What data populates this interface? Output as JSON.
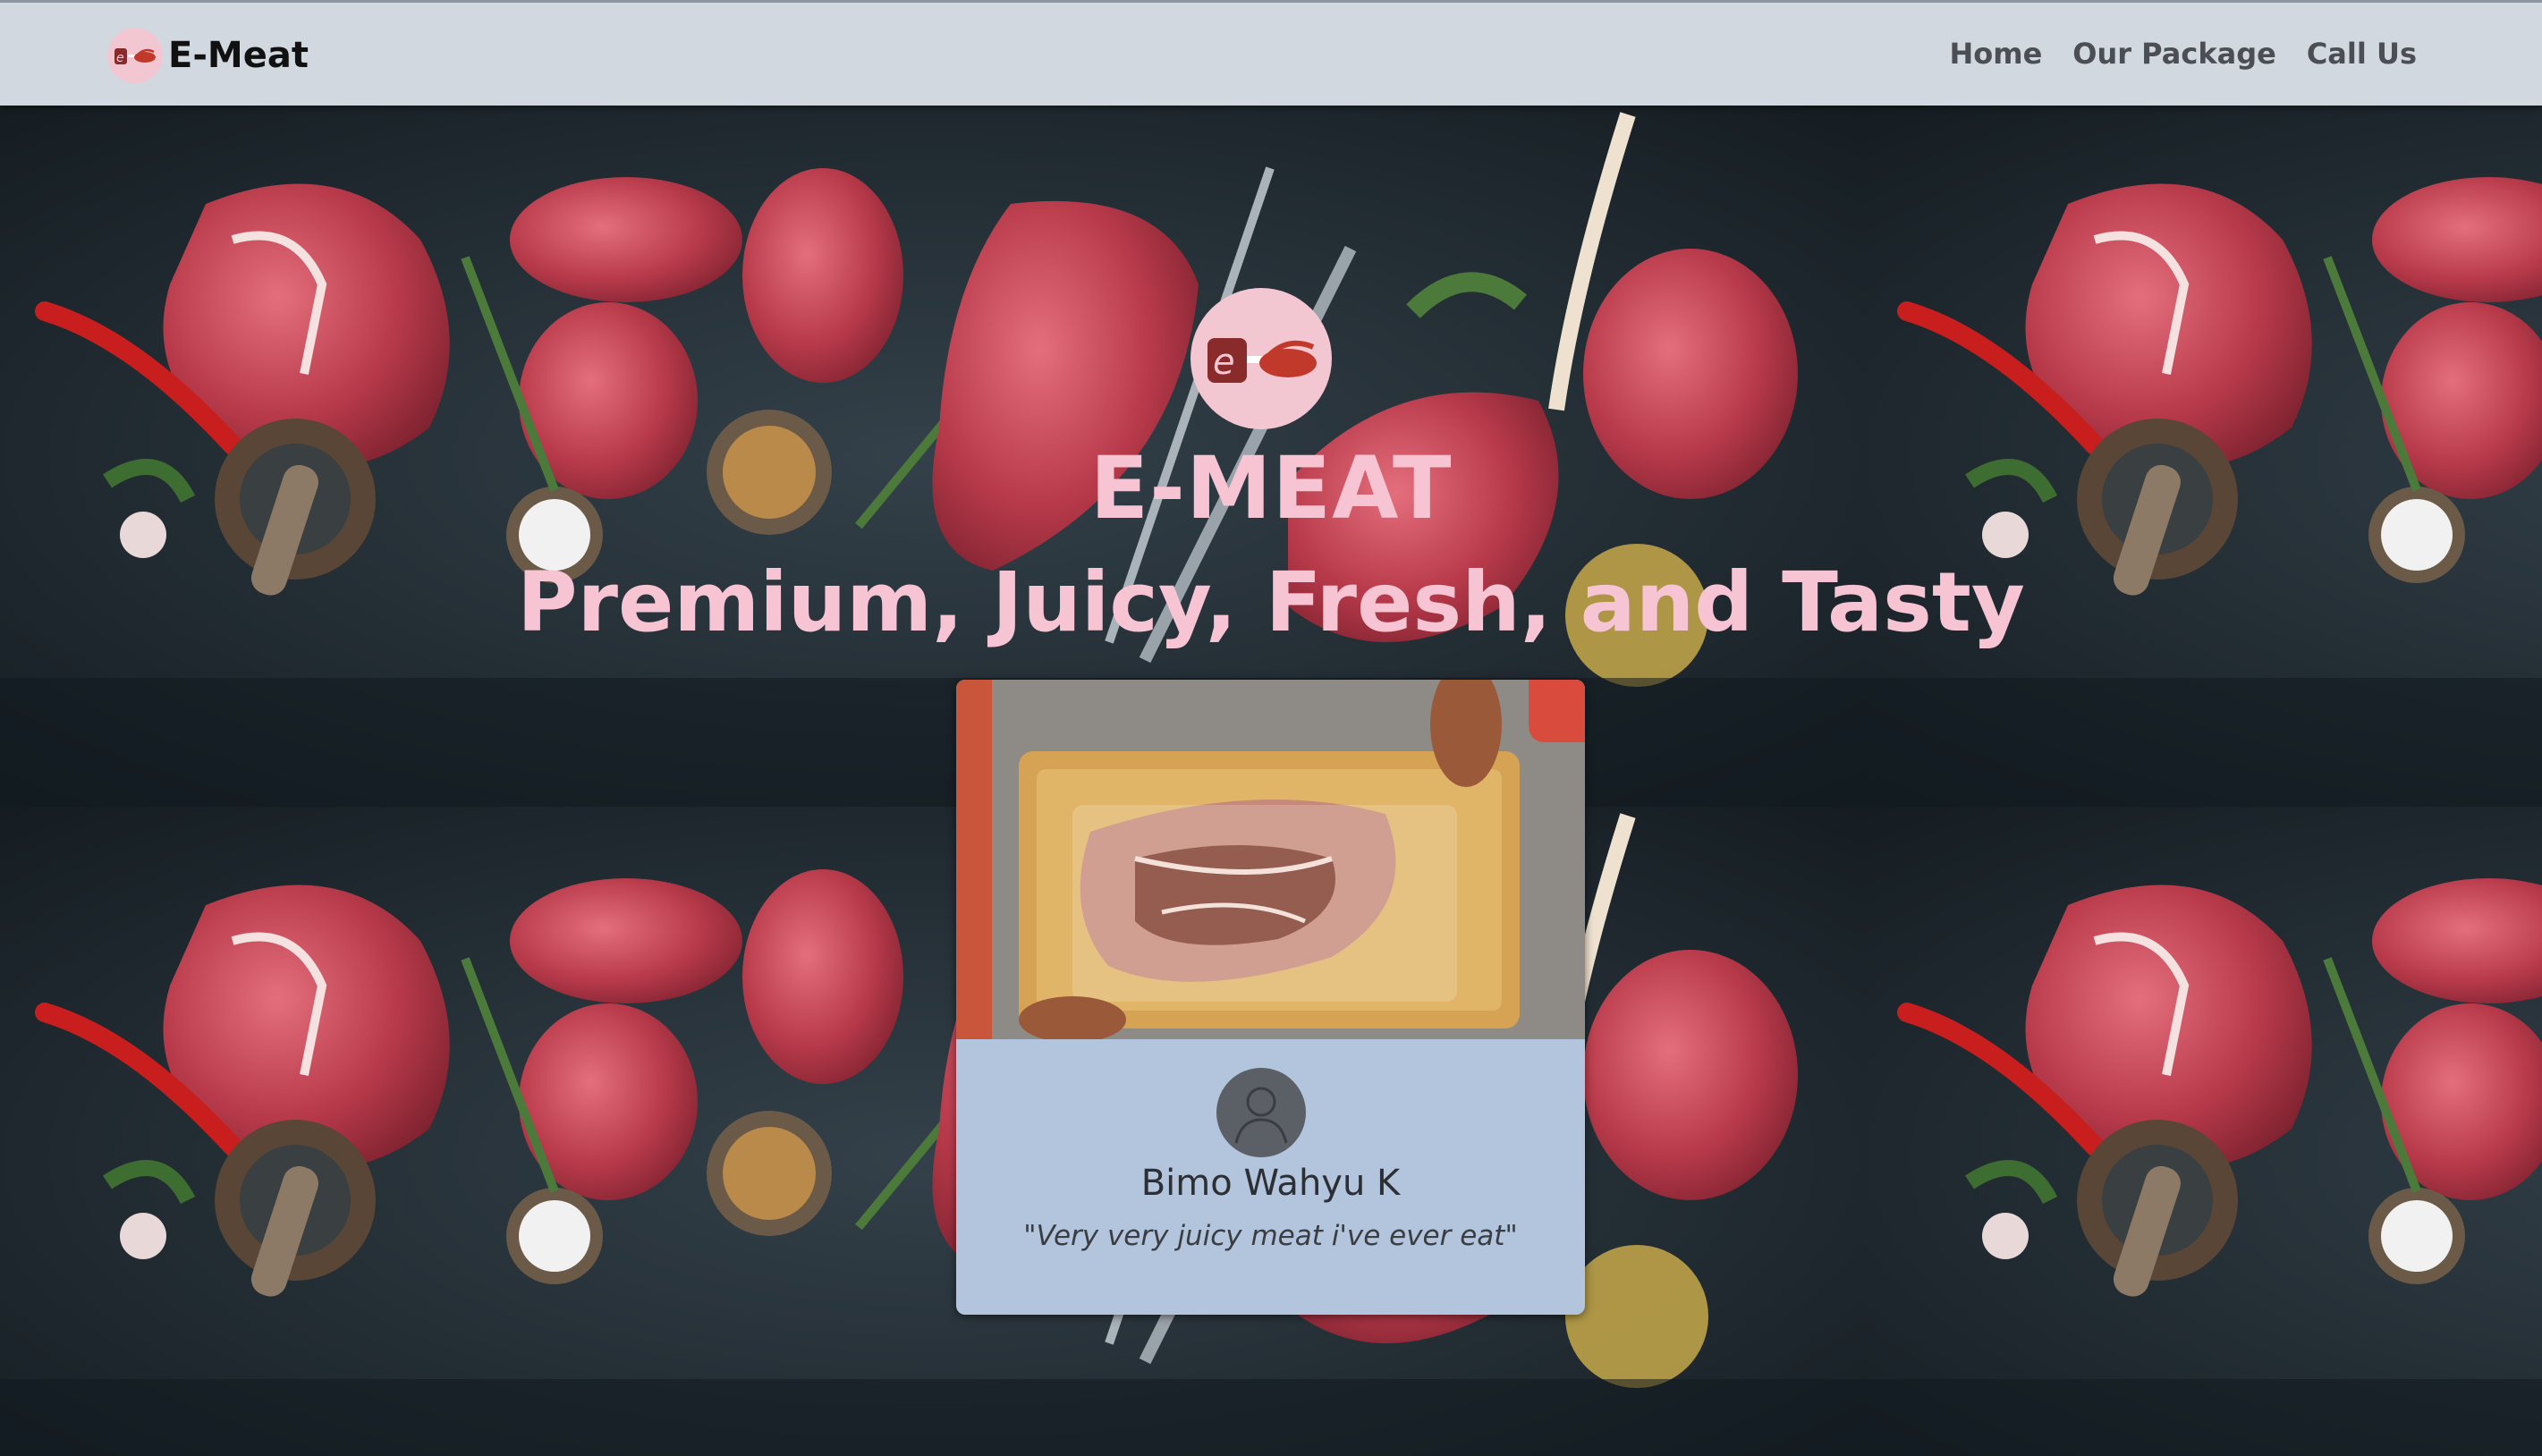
{
  "navbar": {
    "brand_name": "E-Meat",
    "links": [
      {
        "label": "Home"
      },
      {
        "label": "Our Package"
      },
      {
        "label": "Call Us"
      }
    ]
  },
  "hero": {
    "title": "E-MEAT",
    "tagline": "Premium, Juicy, Fresh, and Tasty",
    "background": "meat-board-photo-tiled",
    "logo_icon": "e-meat-logo-icon"
  },
  "testimonial": {
    "photo": "vacuum-packed-steak-on-cutting-board",
    "avatar_icon": "default-user-avatar-icon",
    "name": "Bimo Wahyu K",
    "quote": "\"Very very juicy meat i've ever eat\""
  },
  "colors": {
    "navbar_bg": "#d2d8df",
    "hero_text": "#f6c4d2",
    "logo_bg": "#f3c7d2",
    "card_bg": "#b3c4dd",
    "background_dark": "#1c262c"
  }
}
